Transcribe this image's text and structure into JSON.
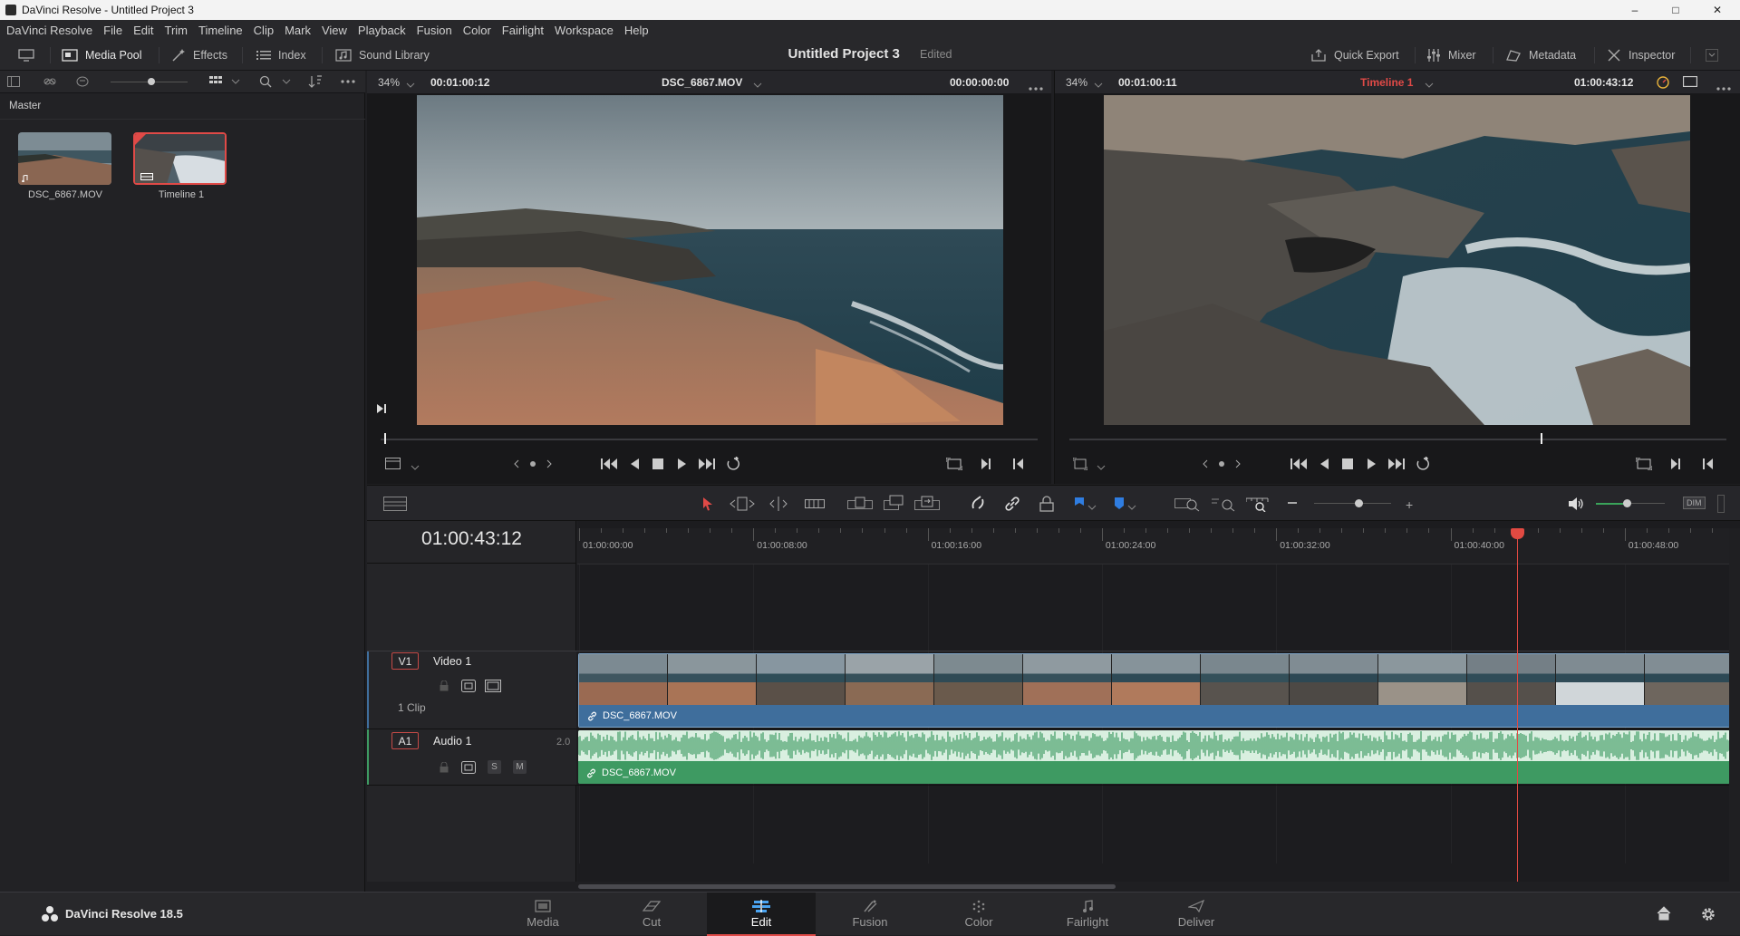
{
  "window": {
    "title": "DaVinci Resolve - Untitled Project 3"
  },
  "menu": [
    "DaVinci Resolve",
    "File",
    "Edit",
    "Trim",
    "Timeline",
    "Clip",
    "Mark",
    "View",
    "Playback",
    "Fusion",
    "Color",
    "Fairlight",
    "Workspace",
    "Help"
  ],
  "toolbar": {
    "media_pool": "Media Pool",
    "effects": "Effects",
    "index": "Index",
    "sound_library": "Sound Library",
    "project_title": "Untitled Project 3",
    "project_status": "Edited",
    "quick_export": "Quick Export",
    "mixer": "Mixer",
    "metadata": "Metadata",
    "inspector": "Inspector"
  },
  "media_pool": {
    "bin": "Master",
    "items": [
      {
        "name": "DSC_6867.MOV"
      },
      {
        "name": "Timeline 1"
      }
    ]
  },
  "source_viewer": {
    "zoom": "34%",
    "duration": "00:01:00:12",
    "clip_name": "DSC_6867.MOV",
    "timecode": "00:00:00:00"
  },
  "timeline_viewer": {
    "zoom": "34%",
    "duration": "00:01:00:11",
    "timeline_name": "Timeline 1",
    "timecode": "01:00:43:12"
  },
  "timeline": {
    "current_timecode": "01:00:43:12",
    "ruler_labels": [
      "01:00:00:00",
      "01:00:08:00",
      "01:00:16:00",
      "01:00:24:00",
      "01:00:32:00",
      "01:00:40:00",
      "01:00:48:00"
    ],
    "playhead_fraction": 0.8147,
    "tracks": {
      "video": {
        "id": "V1",
        "name": "Video 1",
        "clip_count": "1 Clip",
        "clip_name": "DSC_6867.MOV"
      },
      "audio": {
        "id": "A1",
        "name": "Audio 1",
        "channels": "2.0",
        "clip_name": "DSC_6867.MOV",
        "solo": "S",
        "mute": "M"
      }
    }
  },
  "footer": {
    "app_version": "DaVinci Resolve 18.5",
    "pages": [
      "Media",
      "Cut",
      "Edit",
      "Fusion",
      "Color",
      "Fairlight",
      "Deliver"
    ],
    "active_page": "Edit"
  },
  "colors": {
    "accent": "#e04a47",
    "video_clip": "#3f6e9c",
    "audio_clip": "#3e9a62",
    "playhead": "#e24a42"
  }
}
